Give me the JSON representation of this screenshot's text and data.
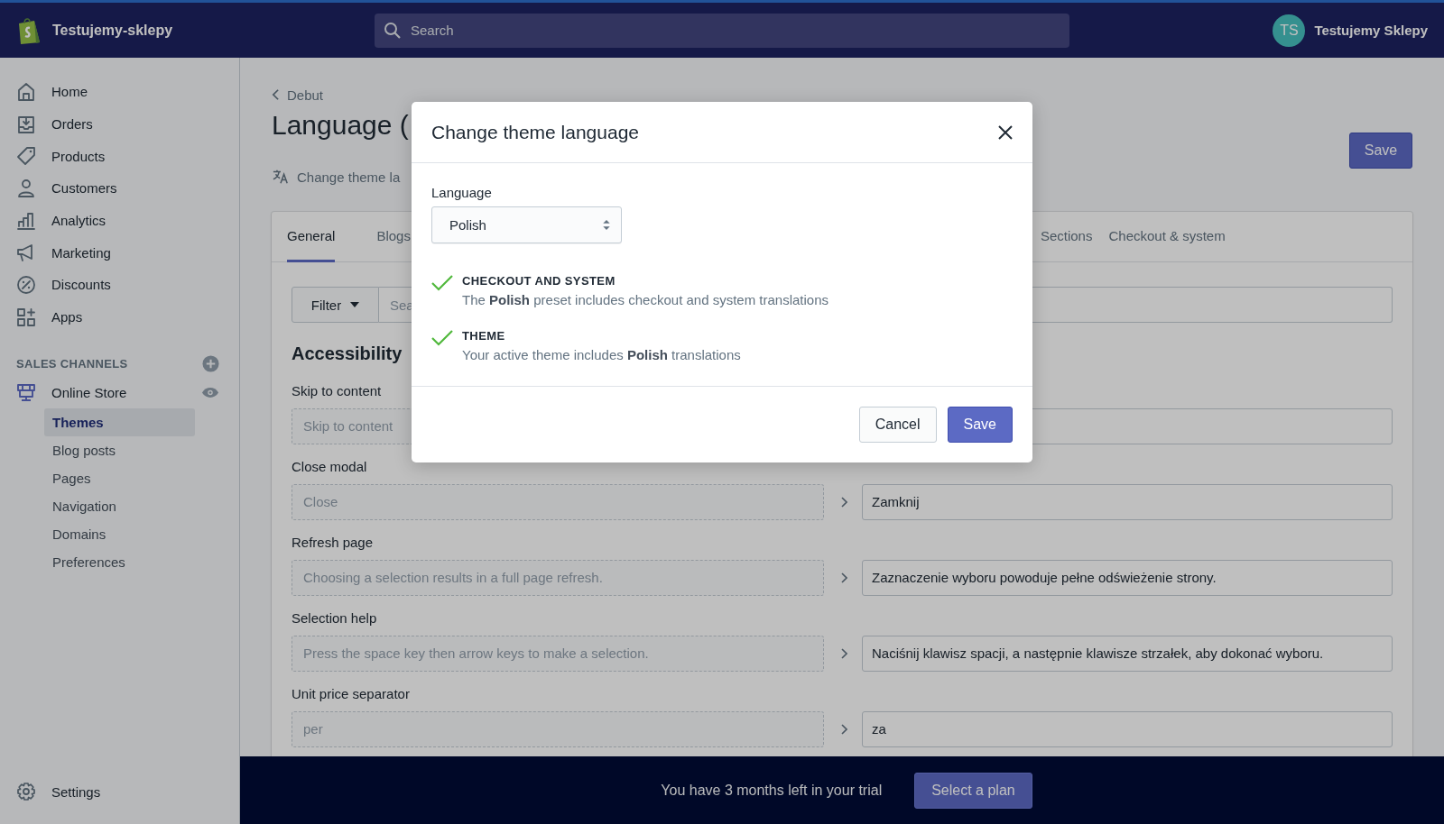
{
  "topbar": {
    "store_name": "Testujemy-sklepy",
    "search": {
      "placeholder": "Search"
    },
    "user": {
      "initials": "TS",
      "name": "Testujemy Sklepy"
    }
  },
  "sidebar": {
    "items": [
      {
        "label": "Home"
      },
      {
        "label": "Orders"
      },
      {
        "label": "Products"
      },
      {
        "label": "Customers"
      },
      {
        "label": "Analytics"
      },
      {
        "label": "Marketing"
      },
      {
        "label": "Discounts"
      },
      {
        "label": "Apps"
      }
    ],
    "sales_channels": {
      "heading": "SALES CHANNELS",
      "channel": {
        "label": "Online Store",
        "children": [
          {
            "label": "Themes",
            "selected": true
          },
          {
            "label": "Blog posts",
            "selected": false
          },
          {
            "label": "Pages",
            "selected": false
          },
          {
            "label": "Navigation",
            "selected": false
          },
          {
            "label": "Domains",
            "selected": false
          },
          {
            "label": "Preferences",
            "selected": false
          }
        ]
      }
    },
    "settings": {
      "label": "Settings"
    }
  },
  "page": {
    "breadcrumb": "Debut",
    "title": "Language (",
    "subtitle_action": "Change theme la",
    "save_button": "Save",
    "tabs": [
      {
        "label": "General",
        "selected": true
      },
      {
        "label": "Blogs",
        "selected": false
      },
      {
        "label": "Sections",
        "selected": false
      },
      {
        "label": "Checkout & system",
        "selected": false
      }
    ],
    "filter_button": "Filter",
    "search": {
      "placeholder": "Sea"
    },
    "section_title": "Accessibility",
    "rows": [
      {
        "label": "Skip to content",
        "source": "Skip to content"
      },
      {
        "label": "Close modal",
        "source": "Close",
        "translation": "Zamknij"
      },
      {
        "label": "Refresh page",
        "source": "Choosing a selection results in a full page refresh.",
        "translation": "Zaznaczenie wyboru powoduje pełne odświeżenie strony."
      },
      {
        "label": "Selection help",
        "source": "Press the space key then arrow keys to make a selection.",
        "translation": "Naciśnij klawisz spacji, a następnie klawisze strzałek, aby dokonać wyboru."
      },
      {
        "label": "Unit price separator",
        "source": "per",
        "translation": "za"
      }
    ]
  },
  "modal": {
    "title": "Change theme language",
    "field_label": "Language",
    "select_value": "Polish",
    "checks": [
      {
        "heading": "CHECKOUT AND SYSTEM",
        "text": "The **Polish** preset includes checkout and system translations"
      },
      {
        "heading": "THEME",
        "text": "Your active theme includes **Polish** translations"
      }
    ],
    "buttons": [
      {
        "label": "Cancel",
        "kind": "secondary"
      },
      {
        "label": "Save",
        "kind": "primary"
      }
    ]
  },
  "trial_bar": {
    "text": "You have 3 months left in your trial",
    "button": "Select a plan"
  }
}
